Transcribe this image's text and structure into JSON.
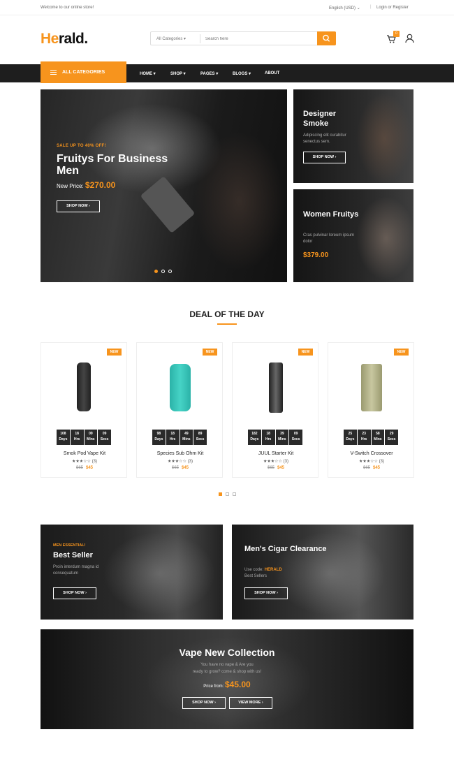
{
  "topbar": {
    "welcome": "Welcome to our online store!",
    "language": "English (USD)",
    "login": "Login or Register"
  },
  "logo": {
    "accent": "He",
    "rest": "rald."
  },
  "search": {
    "category": "All Categories",
    "placeholder": "Search here"
  },
  "cart": {
    "count": "0"
  },
  "nav": {
    "all_categories": "ALL CATEGORIES",
    "items": [
      "HOME",
      "SHOP",
      "PAGES",
      "BLOGS",
      "ABOUT"
    ]
  },
  "hero": {
    "subtitle": "SALE UP TO 40% OFF!",
    "title": "Fruitys For Business Men",
    "price_label": "New Price:",
    "price": "$270.00",
    "button": "SHOP NOW"
  },
  "side1": {
    "title": "Designer Smoke",
    "desc": "Adipiscing elit curabitur senectus sem.",
    "button": "SHOP NOW"
  },
  "side2": {
    "title": "Women Fruitys",
    "desc": "Cras pulvinar loreum ipsum dolor",
    "price": "$379.00"
  },
  "deal": {
    "title": "DEAL OF THE DAY",
    "badge": "NEW",
    "timer_labels": [
      "Days",
      "Hrs",
      "Mins",
      "Secs"
    ],
    "products": [
      {
        "name": "Smok Pod Vape Kit",
        "stars": "★★★☆☆",
        "reviews": "(3)",
        "old": "$65",
        "price": "$45",
        "timer": [
          "108",
          "18",
          "09",
          "09"
        ]
      },
      {
        "name": "Species Sub Ohm Kit",
        "stars": "★★★☆☆",
        "reviews": "(3)",
        "old": "$65",
        "price": "$45",
        "timer": [
          "98",
          "18",
          "49",
          "89"
        ]
      },
      {
        "name": "JUUL Starter Kit",
        "stars": "★★★☆☆",
        "reviews": "(3)",
        "old": "$65",
        "price": "$45",
        "timer": [
          "182",
          "18",
          "39",
          "09"
        ]
      },
      {
        "name": "V-Switch Crossover",
        "stars": "★★★☆☆",
        "reviews": "(3)",
        "old": "$65",
        "price": "$45",
        "timer": [
          "25",
          "23",
          "58",
          "29"
        ]
      }
    ]
  },
  "promo1": {
    "tag": "MEN ESSENTIAL!",
    "title": "Best Seller",
    "desc": "Proin interdum magna id consequatum",
    "button": "SHOP NOW"
  },
  "promo2": {
    "title": "Men's Cigar Clearance",
    "desc_prefix": "Use code:",
    "code": "HERALD",
    "desc_suffix": "Best Sellers",
    "button": "SHOP NOW"
  },
  "banner": {
    "title": "Vape New Collection",
    "desc1": "You have no vape & Are you",
    "desc2": "ready to grow? come & shop with us!",
    "price_label": "Price from:",
    "price": "$45.00",
    "shop": "SHOP NOW",
    "view": "VIEW MORE"
  },
  "colors": {
    "accent": "#f7941d",
    "dark": "#1e1e1e"
  }
}
